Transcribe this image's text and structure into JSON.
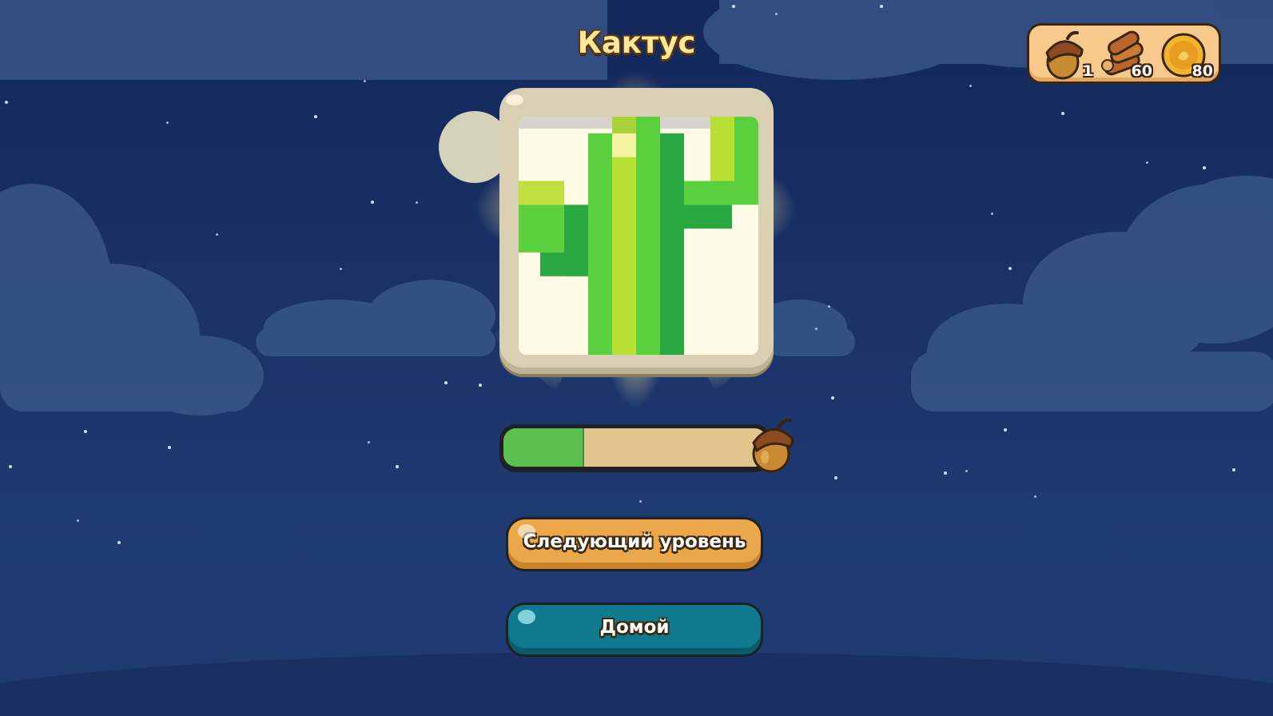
{
  "level": {
    "title": "Кактус",
    "picture_name": "cactus"
  },
  "progress": {
    "fraction": 0.3,
    "reward_icon": "acorn-icon"
  },
  "buttons": {
    "next_label": "Следующий уровень",
    "home_label": "Домой"
  },
  "currency": {
    "acorns": "1",
    "wood": "60",
    "coins": "80"
  },
  "colors": {
    "sky": "#1a3369",
    "next_button": "#eba84a",
    "home_button": "#0f7a8d",
    "progress_fill": "#5cc04f",
    "progress_track": "#e3c68e",
    "title": "#ffe89a"
  }
}
